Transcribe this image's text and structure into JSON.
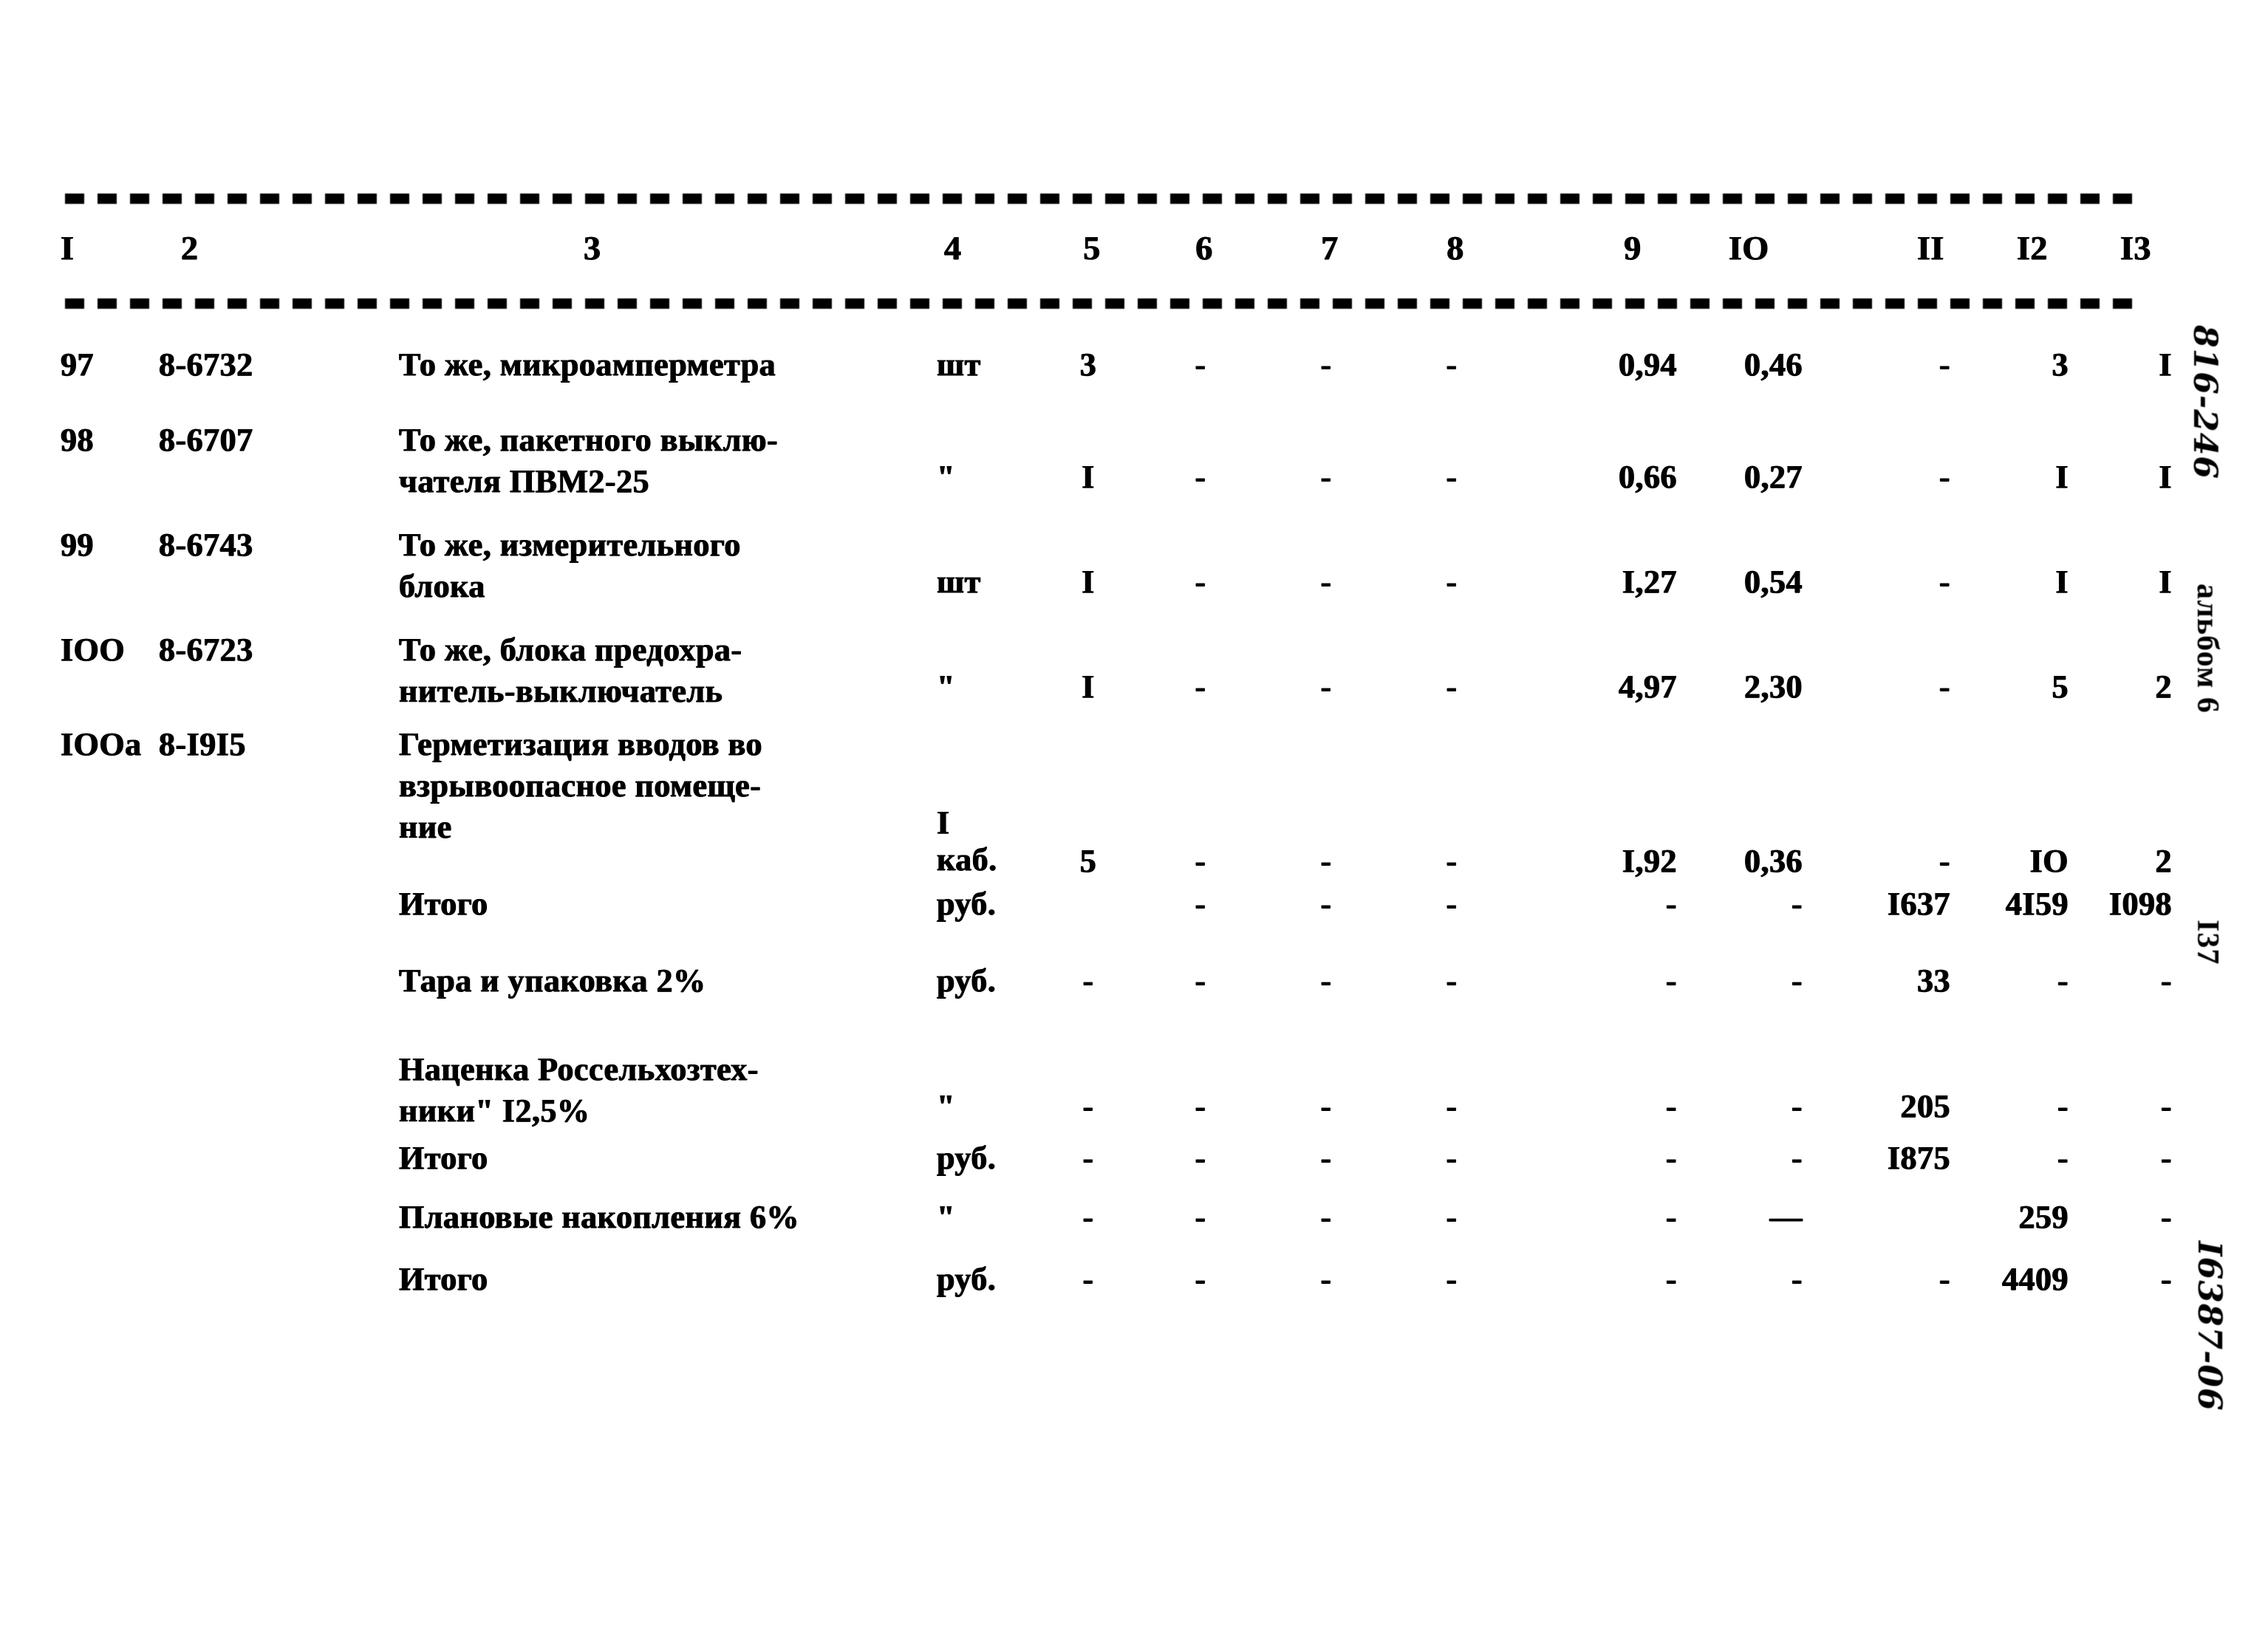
{
  "document": {
    "type": "scanned-estimate-table",
    "page_number": "I37",
    "album_label": "альбом 6",
    "handwritten_top": "816-246",
    "handwritten_bottom": "I6387-06"
  },
  "table": {
    "column_headers": [
      "I",
      "2",
      "3",
      "4",
      "5",
      "6",
      "7",
      "8",
      "9",
      "IO",
      "II",
      "I2",
      "I3"
    ],
    "rows": [
      {
        "num": "97",
        "code": "8-6732",
        "desc_line1": "То же, микроамперметра",
        "desc_line2": "",
        "unit": "шт",
        "c5": "3",
        "c6": "-",
        "c7": "-",
        "c8": "-",
        "c9": "0,94",
        "c10": "0,46",
        "c11": "-",
        "c12": "3",
        "c13": "I"
      },
      {
        "num": "98",
        "code": "8-6707",
        "desc_line1": "То же, пакетного выклю-",
        "desc_line2": "чателя ПВМ2-25",
        "unit": "\"",
        "c5": "I",
        "c6": "-",
        "c7": "-",
        "c8": "-",
        "c9": "0,66",
        "c10": "0,27",
        "c11": "-",
        "c12": "I",
        "c13": "I"
      },
      {
        "num": "99",
        "code": "8-6743",
        "desc_line1": "То же, измерительного",
        "desc_line2": "блока",
        "unit": "шт",
        "c5": "I",
        "c6": "-",
        "c7": "-",
        "c8": "-",
        "c9": "I,27",
        "c10": "0,54",
        "c11": "-",
        "c12": "I",
        "c13": "I"
      },
      {
        "num": "IOO",
        "code": "8-6723",
        "desc_line1": "То же, блока предохра-",
        "desc_line2": "нитель-выключатель",
        "unit": "\"",
        "c5": "I",
        "c6": "-",
        "c7": "-",
        "c8": "-",
        "c9": "4,97",
        "c10": "2,30",
        "c11": "-",
        "c12": "5",
        "c13": "2"
      },
      {
        "num": "IOOa",
        "code": "8-I9I5",
        "desc_line1": "Герметизация вводов во",
        "desc_line2": "взрывоопасное помеще-",
        "desc_line3": "ние",
        "unit_line1": "I",
        "unit_line2": "каб.",
        "c5": "5",
        "c6": "-",
        "c7": "-",
        "c8": "-",
        "c9": "I,92",
        "c10": "0,36",
        "c11": "-",
        "c12": "IO",
        "c13": "2"
      }
    ],
    "summary_rows": [
      {
        "label": "Итого",
        "unit": "руб.",
        "c5": "",
        "c6": "-",
        "c7": "-",
        "c8": "-",
        "c9": "-",
        "c10": "-",
        "c11": "I637",
        "c12": "4I59",
        "c13": "I098"
      },
      {
        "label": "Тара и упаковка 2%",
        "unit": "руб.",
        "c5": "-",
        "c6": "-",
        "c7": "-",
        "c8": "-",
        "c9": "-",
        "c10": "-",
        "c11": "33",
        "c12": "-",
        "c13": "-"
      },
      {
        "label": "Наценка Россельхозтех-",
        "label2": "ники\" I2,5%",
        "unit": "\"",
        "c5": "-",
        "c6": "-",
        "c7": "-",
        "c8": "-",
        "c9": "-",
        "c10": "-",
        "c11": "205",
        "c12": "-",
        "c13": "-"
      },
      {
        "label": "Итого",
        "unit": "руб.",
        "c5": "-",
        "c6": "-",
        "c7": "-",
        "c8": "-",
        "c9": "-",
        "c10": "-",
        "c11": "I875",
        "c12": "-",
        "c13": "-"
      },
      {
        "label": "Плановые накопления 6%",
        "unit": "\"",
        "c5": "-",
        "c6": "-",
        "c7": "-",
        "c8": "-",
        "c9": "-",
        "c10": "—",
        "c11": "",
        "c12": "259",
        "c13": "-"
      },
      {
        "label": "Итого",
        "unit": "руб.",
        "c5": "-",
        "c6": "-",
        "c7": "-",
        "c8": "-",
        "c9": "-",
        "c10": "-",
        "c11": "-",
        "c12": "4409",
        "c13": "-"
      }
    ]
  }
}
